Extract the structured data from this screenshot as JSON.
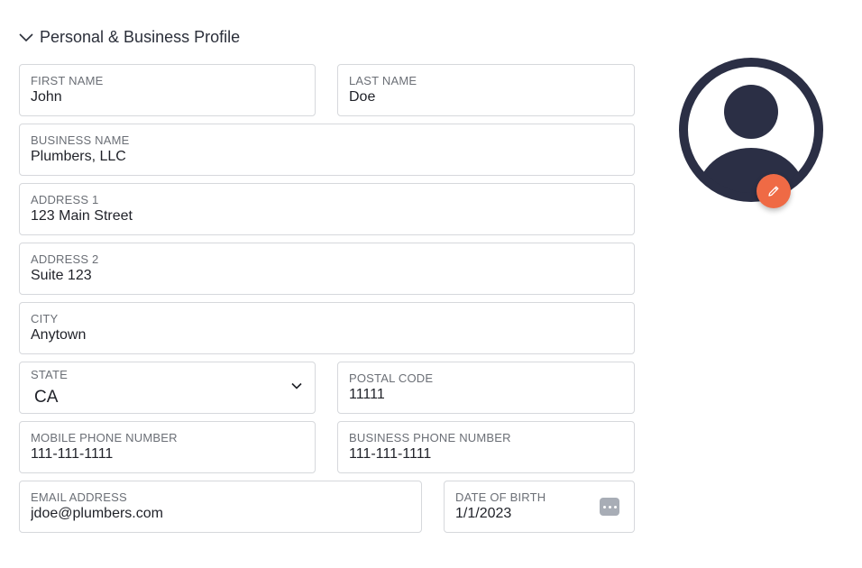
{
  "section": {
    "title": "Personal & Business Profile",
    "expanded_icon": "chevron-down-icon"
  },
  "fields": {
    "first_name": {
      "label": "FIRST NAME",
      "value": "John"
    },
    "last_name": {
      "label": "LAST NAME",
      "value": "Doe"
    },
    "business_name": {
      "label": "BUSINESS NAME",
      "value": "Plumbers, LLC"
    },
    "address1": {
      "label": "ADDRESS 1",
      "value": "123 Main Street"
    },
    "address2": {
      "label": "ADDRESS 2",
      "value": "Suite 123"
    },
    "city": {
      "label": "CITY",
      "value": "Anytown"
    },
    "state": {
      "label": "STATE",
      "value": "CA"
    },
    "postal_code": {
      "label": "POSTAL CODE",
      "value": "11111"
    },
    "mobile_phone": {
      "label": "MOBILE PHONE NUMBER",
      "value": "111-111-1111"
    },
    "business_phone": {
      "label": "BUSINESS PHONE NUMBER",
      "value": "111-111-1111"
    },
    "email": {
      "label": "EMAIL ADDRESS",
      "value": "jdoe@plumbers.com"
    },
    "dob": {
      "label": "DATE OF BIRTH",
      "value": "1/1/2023"
    }
  },
  "avatar": {
    "icon": "user-avatar-icon",
    "edit_icon": "pencil-icon"
  },
  "colors": {
    "avatar": "#2b2f45",
    "accent": "#ef6a45",
    "border": "#d6d8dc",
    "label": "#6b6f76"
  }
}
